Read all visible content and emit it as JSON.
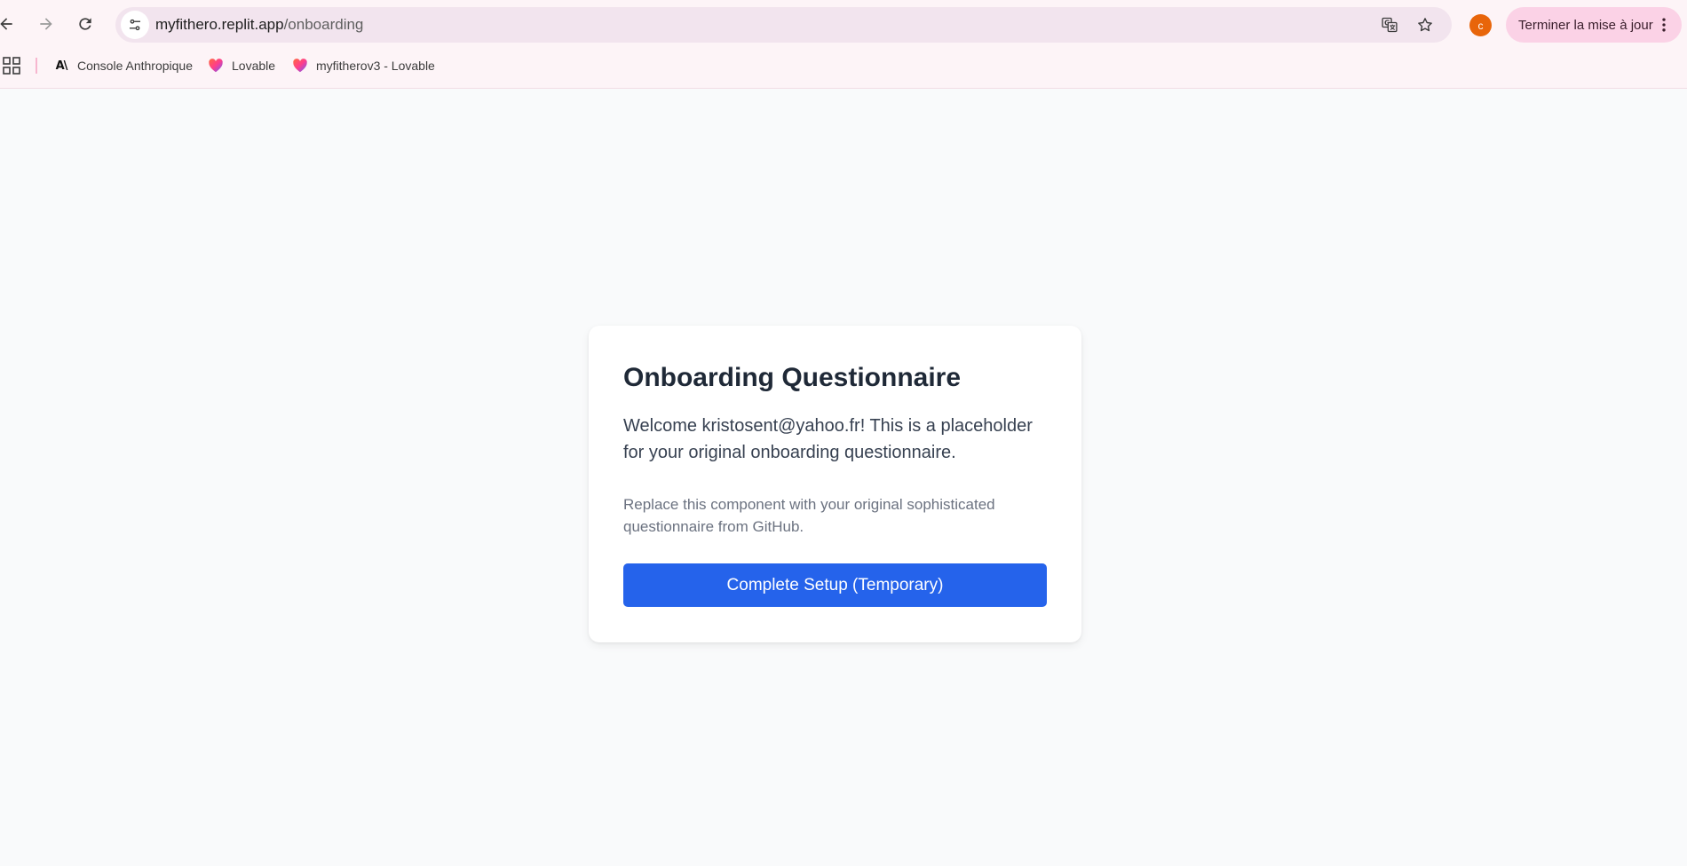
{
  "browser": {
    "url_host": "myfithero.replit.app",
    "url_path": "/onboarding",
    "profile_initial": "c",
    "update_button_label": "Terminer la mise à jour",
    "bookmarks": [
      {
        "label": "Console Anthropique",
        "icon": "anthropic-logo-icon"
      },
      {
        "label": "Lovable",
        "icon": "lovable-heart-icon"
      },
      {
        "label": "myfitherov3 - Lovable",
        "icon": "lovable-heart-icon"
      }
    ],
    "colors": {
      "profile_avatar": "#e8650a",
      "update_button_bg": "#fbd2e6",
      "omnibox_bg": "#f2e4ee"
    }
  },
  "card": {
    "title": "Onboarding Questionnaire",
    "welcome_text": "Welcome kristosent@yahoo.fr! This is a placeholder for your original onboarding questionnaire.",
    "note_text": "Replace this component with your original sophisticated questionnaire from GitHub.",
    "cta_label": "Complete Setup (Temporary)",
    "colors": {
      "cta_bg": "#2563eb",
      "title": "#1f2937"
    }
  }
}
